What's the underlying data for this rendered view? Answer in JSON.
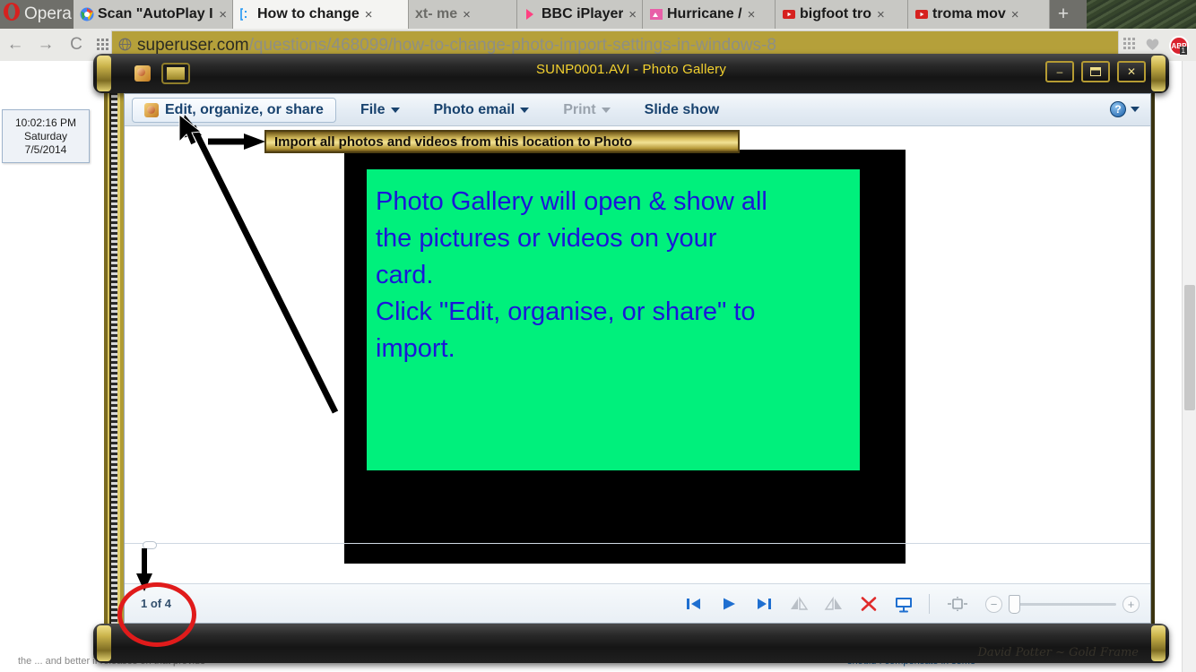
{
  "browser": {
    "opera_label": "Opera",
    "tabs": [
      {
        "title": "Scan \"AutoPlay Im",
        "favicon": "chrome-icon",
        "active": false,
        "close": "×"
      },
      {
        "title": "How to change",
        "favicon": "stackexchange-icon",
        "active": true,
        "close": "×"
      },
      {
        "title": "xt- me",
        "favicon": "generic-icon",
        "active": false,
        "close": "×"
      },
      {
        "title": "BBC iPlayer",
        "favicon": "bbc-icon",
        "active": false,
        "close": "×"
      },
      {
        "title": "Hurricane /",
        "favicon": "pink-icon",
        "active": false,
        "close": "×"
      },
      {
        "title": "bigfoot tro",
        "favicon": "youtube-icon",
        "active": false,
        "close": "×"
      },
      {
        "title": "troma mov",
        "favicon": "youtube-icon",
        "active": false,
        "close": "×"
      }
    ],
    "new_tab_label": "+",
    "nav": {
      "back": "←",
      "forward": "→",
      "reload": "C",
      "apps": "grid-icon"
    },
    "url": {
      "host": "superuser.com",
      "path": "/questions/468099/how-to-change-photo-import-settings-in-windows-8"
    },
    "security_icon": "globe-icon",
    "toolbar_right": {
      "grid": "apps-grid-icon",
      "heart": "bookmark-heart-icon",
      "adblock": "ABP",
      "adblock_badge": "1"
    },
    "page_footer_left": "the ... and better if releases on that provide",
    "page_footer_link": "should I compensate in some"
  },
  "clock_gadget": {
    "time": "10:02:16 PM",
    "day": "Saturday",
    "date": "7/5/2014"
  },
  "window": {
    "title": "SUNP0001.AVI - Photo Gallery",
    "icons": {
      "app": "photo-gallery-icon",
      "restore": "restore-window-icon"
    },
    "controls": {
      "minimize": "–",
      "restore": "❐",
      "close": "✕"
    },
    "frame_signature": "David Potter ~ Gold Frame"
  },
  "gallery": {
    "menu": {
      "primary": {
        "label": "Edit, organize, or share",
        "icon": "photo-gallery-icon"
      },
      "items": [
        {
          "label": "File",
          "has_caret": true,
          "disabled": false
        },
        {
          "label": "Photo email",
          "has_caret": true,
          "disabled": false
        },
        {
          "label": "Print",
          "has_caret": true,
          "disabled": true
        },
        {
          "label": "Slide show",
          "has_caret": false,
          "disabled": false
        }
      ],
      "help": {
        "icon": "help-question-icon",
        "caret": true
      }
    },
    "slide_text": [
      "Photo Gallery will open & show all",
      "the pictures or videos on your",
      "card.",
      "Click \"Edit, organise, or share\" to",
      "import."
    ],
    "status": {
      "count_label": "1 of 4"
    },
    "controls": [
      {
        "name": "previous-button",
        "icon": "skip-previous-icon",
        "color": "#1f6fd0",
        "disabled": false
      },
      {
        "name": "play-button",
        "icon": "play-icon",
        "color": "#1f6fd0",
        "disabled": false
      },
      {
        "name": "next-button",
        "icon": "skip-next-icon",
        "color": "#1f6fd0",
        "disabled": false
      },
      {
        "name": "rotate-left-button",
        "icon": "rotate-counterclockwise-icon",
        "color": "#b9bfc6",
        "disabled": true
      },
      {
        "name": "rotate-right-button",
        "icon": "rotate-clockwise-icon",
        "color": "#b9bfc6",
        "disabled": true
      },
      {
        "name": "delete-button",
        "icon": "delete-x-icon",
        "color": "#e02b2b",
        "disabled": false
      },
      {
        "name": "slideshow-button",
        "icon": "slideshow-screen-icon",
        "color": "#1f6fd0",
        "disabled": false
      }
    ],
    "zoom": {
      "fit_icon": "fit-to-window-icon",
      "minus": "−",
      "plus": "+",
      "value": 0
    }
  },
  "annotations": {
    "tooltip_text": "Import all photos and videos from this location to Photo",
    "arrow_to_menu": "long-diagonal-arrow",
    "arrow_to_tooltip": "short-right-arrow",
    "arrow_to_count": "down-arrow",
    "circle_highlight": "red-ellipse-highlight",
    "colors": {
      "highlight_circle": "#e01b1b",
      "tooltip_gold": "#d8bf5e",
      "slide_bg": "#00f07c",
      "slide_text": "#1b16d8",
      "title_yellow": "#f3d12f"
    }
  }
}
